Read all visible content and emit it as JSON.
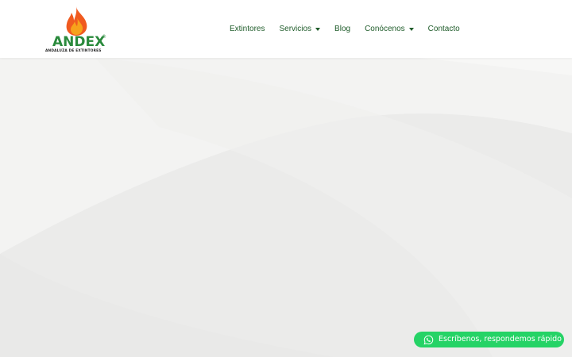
{
  "colors": {
    "brand_green": "#2a8a3c",
    "nav_text": "#1f5c2a",
    "flame_orange": "#f05a1f",
    "flame_yellow": "#f7a21b",
    "whatsapp_green": "#25d366",
    "background": "#f1f1f0"
  },
  "header": {
    "logo": {
      "name": "ANDEX",
      "registered_mark": "®",
      "tagline": "ANDALUZA DE EXTINTORES",
      "icon": "flame-icon"
    },
    "nav": [
      {
        "label": "Extintores",
        "dropdown": false
      },
      {
        "label": "Servicios",
        "dropdown": true,
        "icon": "caret-down-icon"
      },
      {
        "label": "Blog",
        "dropdown": false
      },
      {
        "label": "Conócenos",
        "dropdown": true,
        "icon": "caret-down-icon"
      },
      {
        "label": "Contacto",
        "dropdown": false
      }
    ]
  },
  "whatsapp_button": {
    "label": "Escríbenos, respondemos rápido",
    "icon": "whatsapp-icon"
  }
}
